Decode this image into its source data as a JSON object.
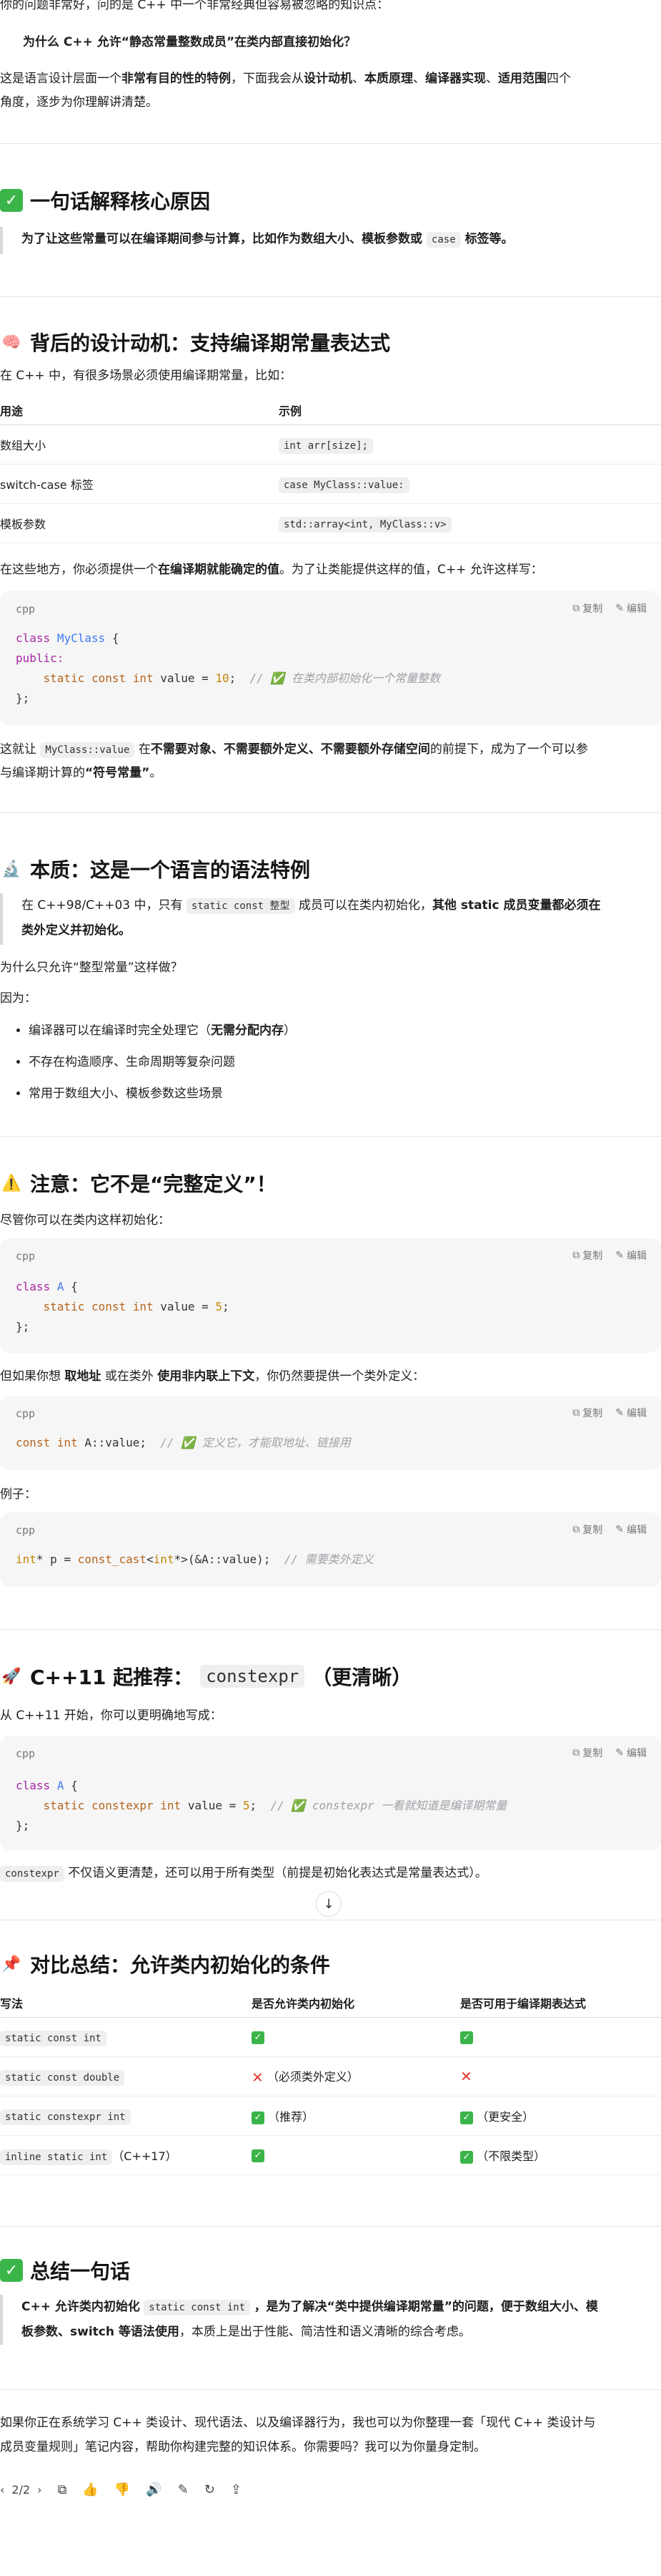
{
  "intro": {
    "line1": "你的问题非常好，问的是 C++ 中一个非常经典但容易被忽略的知识点：",
    "question": "为什么 C++ 允许“静态常量整数成员”在类内部直接初始化？",
    "line3_a": "这是语言设计层面一个",
    "line3_b": "非常有目的性的特例",
    "line3_c": "，下面我会从",
    "line3_d": "设计动机",
    "line3_e": "、",
    "line3_f": "本质原理",
    "line3_g": "、",
    "line3_h": "编译器实现",
    "line3_i": "、",
    "line3_j": "适用范围",
    "line3_k": "四个",
    "line4": "角度，逐步为你理解讲清楚。"
  },
  "s1": {
    "icon": "check-box-icon",
    "title": "一句话解释核心原因",
    "quote_a": "为了让这些常量可以在编译期间参与计算，比如作为数组大小、模板参数或",
    "quote_code": "case",
    "quote_b": "标签等。"
  },
  "s2": {
    "icon": "brain-emoji",
    "title": "背后的设计动机：支持编译期常量表达式",
    "lead": "在 C++ 中，有很多场景必须使用编译期常量，比如：",
    "table": {
      "headers": [
        "用途",
        "示例"
      ],
      "rows": [
        [
          "数组大小",
          "int arr[size];"
        ],
        [
          "switch-case 标签",
          "case MyClass::value:"
        ],
        [
          "模板参数",
          "std::array<int, MyClass::v>"
        ]
      ]
    },
    "para_a": "在这些地方，你必须提供一个",
    "para_b": "在编译期就能确定的值",
    "para_c": "。为了让类能提供这样的值，C++ 允许这样写：",
    "code": {
      "lang": "cpp",
      "copy": "复制",
      "edit": "编辑",
      "l1_kw": "class",
      "l1_cls": "MyClass",
      "l1_rest": " {",
      "l2": "public:",
      "l3_kw": "static const int",
      "l3_mid": " value = ",
      "l3_num": "10",
      "l3_semi": ";",
      "l3_cm": "// ✅ 在类内部初始化一个常量整数",
      "l4": "};"
    },
    "after_a": "这就让",
    "after_code": "MyClass::value",
    "after_b": "在",
    "after_c": "不需要对象、不需要额外定义、不需要额外存储空间",
    "after_d": "的前提下，成为了一个可以参",
    "after_e": "与编译期计算的",
    "after_f": "“符号常量”",
    "after_g": "。"
  },
  "s3": {
    "icon": "microscope-emoji",
    "title": "本质：这是一个语言的语法特例",
    "quote_a": "在 C++98/C++03 中，只有",
    "quote_code": "static const 整型",
    "quote_b": "成员可以在类内初始化，",
    "quote_c": "其他 static 成员变量都必须在",
    "quote_d": "类外定义并初始化。",
    "why": "为什么只允许“整型常量”这样做？",
    "because": "因为：",
    "bullets": [
      "编译器可以在编译时完全处理它（",
      "不存在构造顺序、生命周期等复杂问题",
      "常用于数组大小、模板参数这些场景"
    ],
    "bullet1_bold": "无需分配内存",
    "bullet1_end": "）"
  },
  "s4": {
    "icon": "warning-emoji",
    "title": "注意：它不是“完整定义”！",
    "lead": "尽管你可以在类内这样初始化：",
    "code1": {
      "lang": "cpp",
      "copy": "复制",
      "edit": "编辑",
      "l1_kw": "class",
      "l1_cls": "A",
      "l1_rest": " {",
      "l2_kw": "static const int",
      "l2_mid": " value = ",
      "l2_num": "5",
      "l2_semi": ";",
      "l3": "};"
    },
    "mid_a": "但如果你想",
    "mid_b": "取地址",
    "mid_c": "或在类外",
    "mid_d": "使用非内联上下文",
    "mid_e": "，你仍然要提供一个类外定义：",
    "code2": {
      "lang": "cpp",
      "copy": "复制",
      "edit": "编辑",
      "kw": "const int",
      "mid": " A::value;  ",
      "cm": "// ✅ 定义它，才能取地址、链接用"
    },
    "example": "例子：",
    "code3": {
      "lang": "cpp",
      "copy": "复制",
      "edit": "编辑",
      "t": "int",
      "a": "* p = ",
      "fn": "const_cast",
      "b": "<",
      "t2": "int",
      "c": "*>(&A::value);  ",
      "cm": "// 需要类外定义"
    }
  },
  "s5": {
    "icon": "rocket-emoji",
    "title_a": "C++11 起推荐：",
    "title_code": "constexpr",
    "title_b": "（更清晰）",
    "lead": "从 C++11 开始，你可以更明确地写成：",
    "code": {
      "lang": "cpp",
      "copy": "复制",
      "edit": "编辑",
      "l1_kw": "class",
      "l1_cls": "A",
      "l1_rest": " {",
      "l2_kw": "static constexpr int",
      "l2_mid": " value = ",
      "l2_num": "5",
      "l2_semi": ";",
      "l2_cm": "// ✅ constexpr 一看就知道是编译期常量",
      "l3": "};"
    },
    "after_code": "constexpr",
    "after_text": "不仅语义更清楚，还可以用于所有类型（前提是初始化表达式是常量表达式）。"
  },
  "s6": {
    "icon": "pin-emoji",
    "title": "对比总结：允许类内初始化的条件",
    "table": {
      "headers": [
        "写法",
        "是否允许类内初始化",
        "是否可用于编译期表达式"
      ],
      "rows": [
        {
          "code": "static const int",
          "tail": "",
          "a_mark": "check",
          "a_text": "",
          "b_mark": "check",
          "b_text": ""
        },
        {
          "code": "static const double",
          "tail": "",
          "a_mark": "cross",
          "a_text": "（必须类外定义）",
          "b_mark": "cross",
          "b_text": ""
        },
        {
          "code": "static constexpr int",
          "tail": "",
          "a_mark": "check",
          "a_text": "（推荐）",
          "b_mark": "check",
          "b_text": "（更安全）"
        },
        {
          "code": "inline static int",
          "tail": "（C++17）",
          "a_mark": "check",
          "a_text": "",
          "b_mark": "check",
          "b_text": "（不限类型）"
        }
      ]
    }
  },
  "s7": {
    "icon": "check-box-icon",
    "title": "总结一句话",
    "q_a": "C++ 允许类内初始化",
    "q_code": "static const int",
    "q_b": "，是为了解决“类中提供编译期常量”的问题，便于数组大小、模",
    "q_c": "板参数、switch 等语法使用",
    "q_d": "，本质上是出于性能、简洁性和语义清晰的综合考虑。"
  },
  "closing": {
    "line1": "如果你正在系统学习 C++ 类设计、现代语法、以及编译器行为，我也可以为你整理一套「现代 C++ 类设计与",
    "line2": "成员变量规则」笔记内容，帮助你构建完整的知识体系。你需要吗？我可以为你量身定制。"
  },
  "footer": {
    "page": "2/2"
  }
}
